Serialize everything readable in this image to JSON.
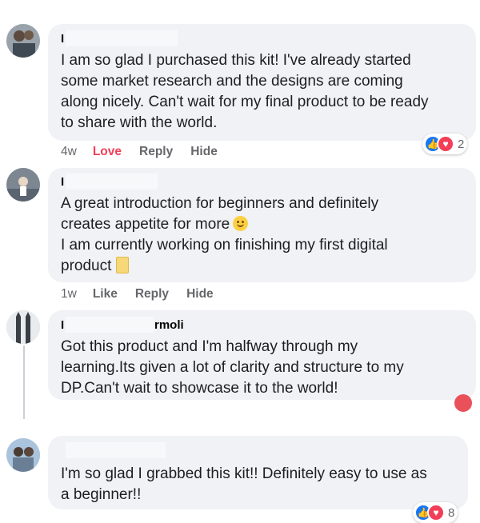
{
  "comments": [
    {
      "name": "I",
      "lines": [
        "I am so glad I purchased this kit! I've already started",
        "some market research and the designs are coming",
        "along nicely. Can't wait for my final product to be ready",
        "to share with the world."
      ],
      "time": "4w",
      "reaction_label": "Love",
      "reply_label": "Reply",
      "hide_label": "Hide",
      "reaction_count": "2"
    },
    {
      "name": "I",
      "lines": [
        "A great introduction for beginners and definitely",
        "creates appetite for more",
        "I am currently working on finishing my first digital",
        "product"
      ],
      "time": "1w",
      "reaction_label": "Like",
      "reply_label": "Reply",
      "hide_label": "Hide"
    },
    {
      "name": "I",
      "name_suffix": "rmoli",
      "lines": [
        "Got this product and I'm halfway through my",
        "learning.Its given a lot of clarity and structure to my",
        "DP.Can't wait to showcase it to the world!"
      ]
    },
    {
      "lines": [
        "I'm so glad I grabbed this kit!! Definitely easy to use as",
        "a beginner!!"
      ],
      "reaction_count": "8"
    }
  ],
  "colors": {
    "bubble": "#f0f2f5",
    "like": "#1877f2",
    "love": "#f33e58",
    "meta": "#65676b"
  }
}
